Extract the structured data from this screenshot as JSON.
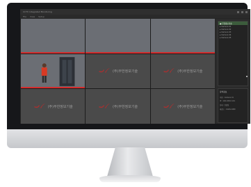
{
  "window": {
    "title": "CCTV Integrated Monitoring",
    "menu": [
      "File",
      "View",
      "Setup"
    ]
  },
  "tiles": {
    "logo_text": "(주)무한정보기술",
    "brand_color": "#d52b2b"
  },
  "side_panel": {
    "tree_items": [
      "▣ 무한정보기술",
      "  ▸ Camera 01",
      "  ▸ Camera 02",
      "  ▸ Camera 03",
      "  ▸ Camera 04",
      "  ▸ Camera 05"
    ],
    "info_title": "장치정보",
    "info_rows": [
      "이름 : Camera 01",
      "IP : 192.168.0.101",
      "상태 : 연결됨",
      "해상도 : 1920x1080"
    ]
  }
}
